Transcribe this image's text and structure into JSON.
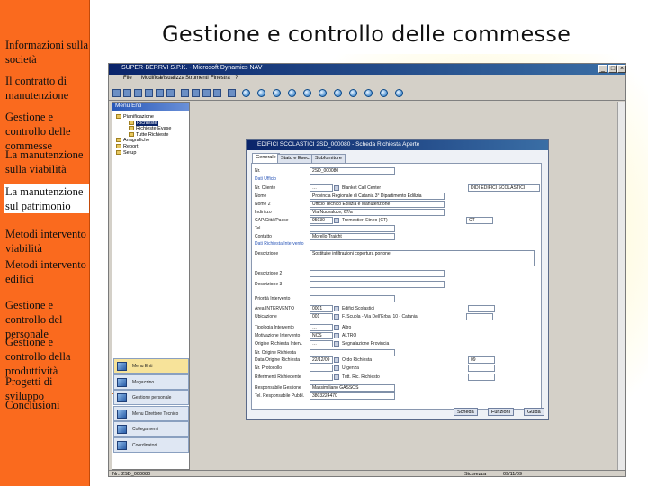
{
  "slide": {
    "title": "Gestione e controllo delle commesse"
  },
  "nav": [
    {
      "text": "Informazioni sulla società",
      "highlight": false
    },
    {
      "text": "Il contratto di manutenzione",
      "highlight": false
    },
    {
      "text": "Gestione e controllo delle commesse",
      "highlight": false
    },
    {
      "text": "La manutenzione sulla viabilità",
      "highlight": false
    },
    {
      "text": "La manutenzione sul patrimonio",
      "highlight": true
    },
    {
      "text": "Metodi intervento viabilità",
      "highlight": false
    },
    {
      "text": "Metodi intervento edifici",
      "highlight": false
    },
    {
      "text": "Gestione e controllo del personale",
      "highlight": false
    },
    {
      "text": "Gestione e controllo della produttività",
      "highlight": false
    },
    {
      "text": "Progetti di sviluppo",
      "highlight": false
    },
    {
      "text": "Conclusioni",
      "highlight": false
    }
  ],
  "app": {
    "window_title": "SUPER-BERRVI S.P.K. - Microsoft Dynamics NAV",
    "menu": [
      "File",
      "Modifica",
      "Visualizza",
      "Strumenti",
      "Finestra",
      "?"
    ],
    "menu_panel_title": "Menu Enti",
    "tree": [
      {
        "text": "Pianificazione",
        "selected": false,
        "indent": 0
      },
      {
        "text": "Richieste",
        "selected": true,
        "indent": 1
      },
      {
        "text": "Richieste Evase",
        "selected": false,
        "indent": 1
      },
      {
        "text": "Tutte Richieste",
        "selected": false,
        "indent": 1
      },
      {
        "text": "Anagrafiche",
        "selected": false,
        "indent": 0
      },
      {
        "text": "Report",
        "selected": false,
        "indent": 0
      },
      {
        "text": "Setup",
        "selected": false,
        "indent": 0
      }
    ],
    "nav_buttons": [
      {
        "label": "Menu Enti",
        "active": true
      },
      {
        "label": "Magazzino",
        "active": false
      },
      {
        "label": "Gestione personale",
        "active": false
      },
      {
        "label": "Menu Direttore Tecnico",
        "active": false
      },
      {
        "label": "Collegamenti",
        "active": false
      },
      {
        "label": "Coordinatori",
        "active": false
      }
    ],
    "status": {
      "left": "Nr.: 2SD_000080",
      "middle": "Sicurezza",
      "right": "09/11/09"
    }
  },
  "dialog": {
    "title": "EDIFICI SCOLASTICI 2SD_000080 - Scheda Richiesta Aperte",
    "tabs": [
      "Generale",
      "Stato e Esec.",
      "Subfornitore"
    ],
    "rows": [
      {
        "label": "Nr.",
        "value": "2SD_000080"
      },
      {
        "label": "Dati Ufficio",
        "section": true
      },
      {
        "label": "Nr. Cliente",
        "value": "…",
        "extra_label": "Blanket Call Center",
        "extra_value": "DIDI EDIFICI SCOLASTICI"
      },
      {
        "label": "Nome",
        "value": "Provincia Regionale di Catania 3° Dipartimento Edilizia"
      },
      {
        "label": "Nome 2",
        "value": "Ufficio Tecnico Edilizia e Manutenzione"
      },
      {
        "label": "Indirizzo",
        "value": "Via Nuovaluce, 67/a"
      },
      {
        "label": "CAP/Città/Paese",
        "value": "95030",
        "extra_label": "Tremestieri Etneo (CT)",
        "extra_value": "CT"
      },
      {
        "label": "Tel.",
        "value": "…"
      },
      {
        "label": "Contatto",
        "value": "Morello Traicht"
      },
      {
        "label": "Dati Richiesta Intervento",
        "section": true
      },
      {
        "label": "Descrizione",
        "value": "Sostituire infiltrazioni copertura portone"
      },
      {
        "label": "Descrizione 2",
        "value": ""
      },
      {
        "label": "Descrizione 3",
        "value": ""
      },
      {
        "label": "Priorità Intervento",
        "value": ""
      },
      {
        "label": "Area INTERVENTO",
        "value": "0001",
        "extra_label": "Edifici Scolastici",
        "extra_value": ""
      },
      {
        "label": "Ubicazione",
        "value": "001",
        "extra_label": "F. Scuola - Via Dell'Erba, 10 - Catania",
        "extra_value": ""
      },
      {
        "label": "Tipologia Intervento",
        "value": "…",
        "extra_label": "Altro"
      },
      {
        "label": "Motivazione Intervento",
        "value": "NCS",
        "extra_label": "ALTRO"
      },
      {
        "label": "Origine Richiesta Interv.",
        "value": "…",
        "extra_label": "Segnalazione Provincia"
      },
      {
        "label": "Nr. Origine Richiesta",
        "value": ""
      },
      {
        "label": "Data Origine Richiesta",
        "value": "22/12/09",
        "extra_label": "Ordo Richiesta",
        "extra_value": "09"
      },
      {
        "label": "Nr. Protocollo",
        "value": "",
        "extra_label": "Urgenza",
        "extra_value": ""
      },
      {
        "label": "Riferimenti Richiedente",
        "value": "",
        "extra_label": "Tutt. Ric. Richiesto",
        "extra_value": ""
      },
      {
        "label": "Responsabile Gestione",
        "value": "Massimiliano GASSOS"
      },
      {
        "label": "Tel. Responsabile Pubbl.",
        "value": "3803224470"
      }
    ],
    "buttons": [
      "Scheda",
      "Funzioni",
      "Guida"
    ]
  }
}
